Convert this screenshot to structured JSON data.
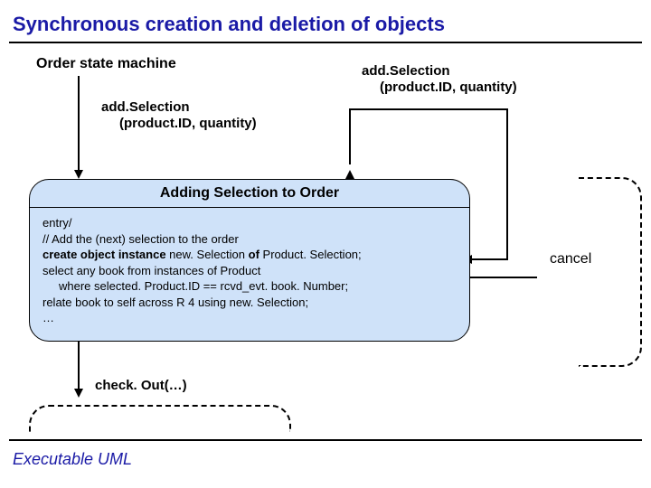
{
  "title": "Synchronous creation and deletion of objects",
  "subheading": "Order state machine",
  "triggers": {
    "left": {
      "line1": "add.Selection",
      "line2": "(product.ID, quantity)"
    },
    "right": {
      "line1": "add.Selection",
      "line2": "(product.ID, quantity)"
    }
  },
  "state": {
    "name": "Adding Selection to Order",
    "body": {
      "l1": "entry/",
      "l2": "// Add the (next) selection to the order",
      "l3_pre": "create object instance",
      "l3_mid": " new. Selection ",
      "l3_of": "of",
      "l3_post": " Product. Selection;",
      "l4": "select any book from instances of Product",
      "l5": "where selected. Product.ID == rcvd_evt. book. Number;",
      "l6": "relate book to self across R 4 using new. Selection;",
      "l7": "…"
    }
  },
  "cancel_label": "cancel",
  "checkout_label": "check. Out(…)",
  "footer": "Executable UML"
}
